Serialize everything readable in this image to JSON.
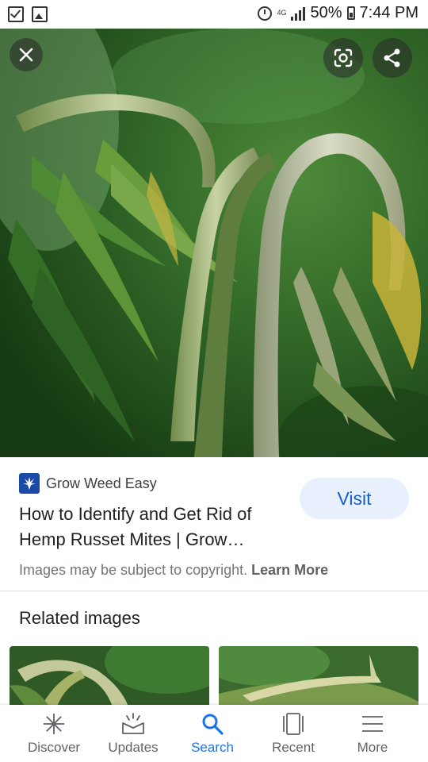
{
  "status_bar": {
    "time": "7:44 PM",
    "battery": "50%",
    "network": "4G",
    "icons": [
      "checkbox-icon",
      "gallery-icon",
      "alarm-icon",
      "signal-icon",
      "battery-icon"
    ]
  },
  "viewer": {
    "close_icon": "close-icon",
    "lens_icon": "lens-icon",
    "share_icon": "share-icon"
  },
  "result": {
    "source": "Grow Weed Easy",
    "title": "How to Identify and Get Rid of Hemp Russet Mites | Grow…",
    "visit_label": "Visit",
    "copyright_text": "Images may be subject to copyright.",
    "learn_more": "Learn More"
  },
  "related": {
    "heading": "Related images"
  },
  "bottom_nav": {
    "items": [
      {
        "label": "Discover",
        "icon": "asterisk-icon"
      },
      {
        "label": "Updates",
        "icon": "updates-tray-icon"
      },
      {
        "label": "Search",
        "icon": "search-icon",
        "active": true
      },
      {
        "label": "Recent",
        "icon": "recent-cards-icon"
      },
      {
        "label": "More",
        "icon": "menu-icon"
      }
    ]
  },
  "colors": {
    "accent": "#1a73e8",
    "visit_bg": "#e8f0fe",
    "source_logo": "#1a4aa6"
  }
}
